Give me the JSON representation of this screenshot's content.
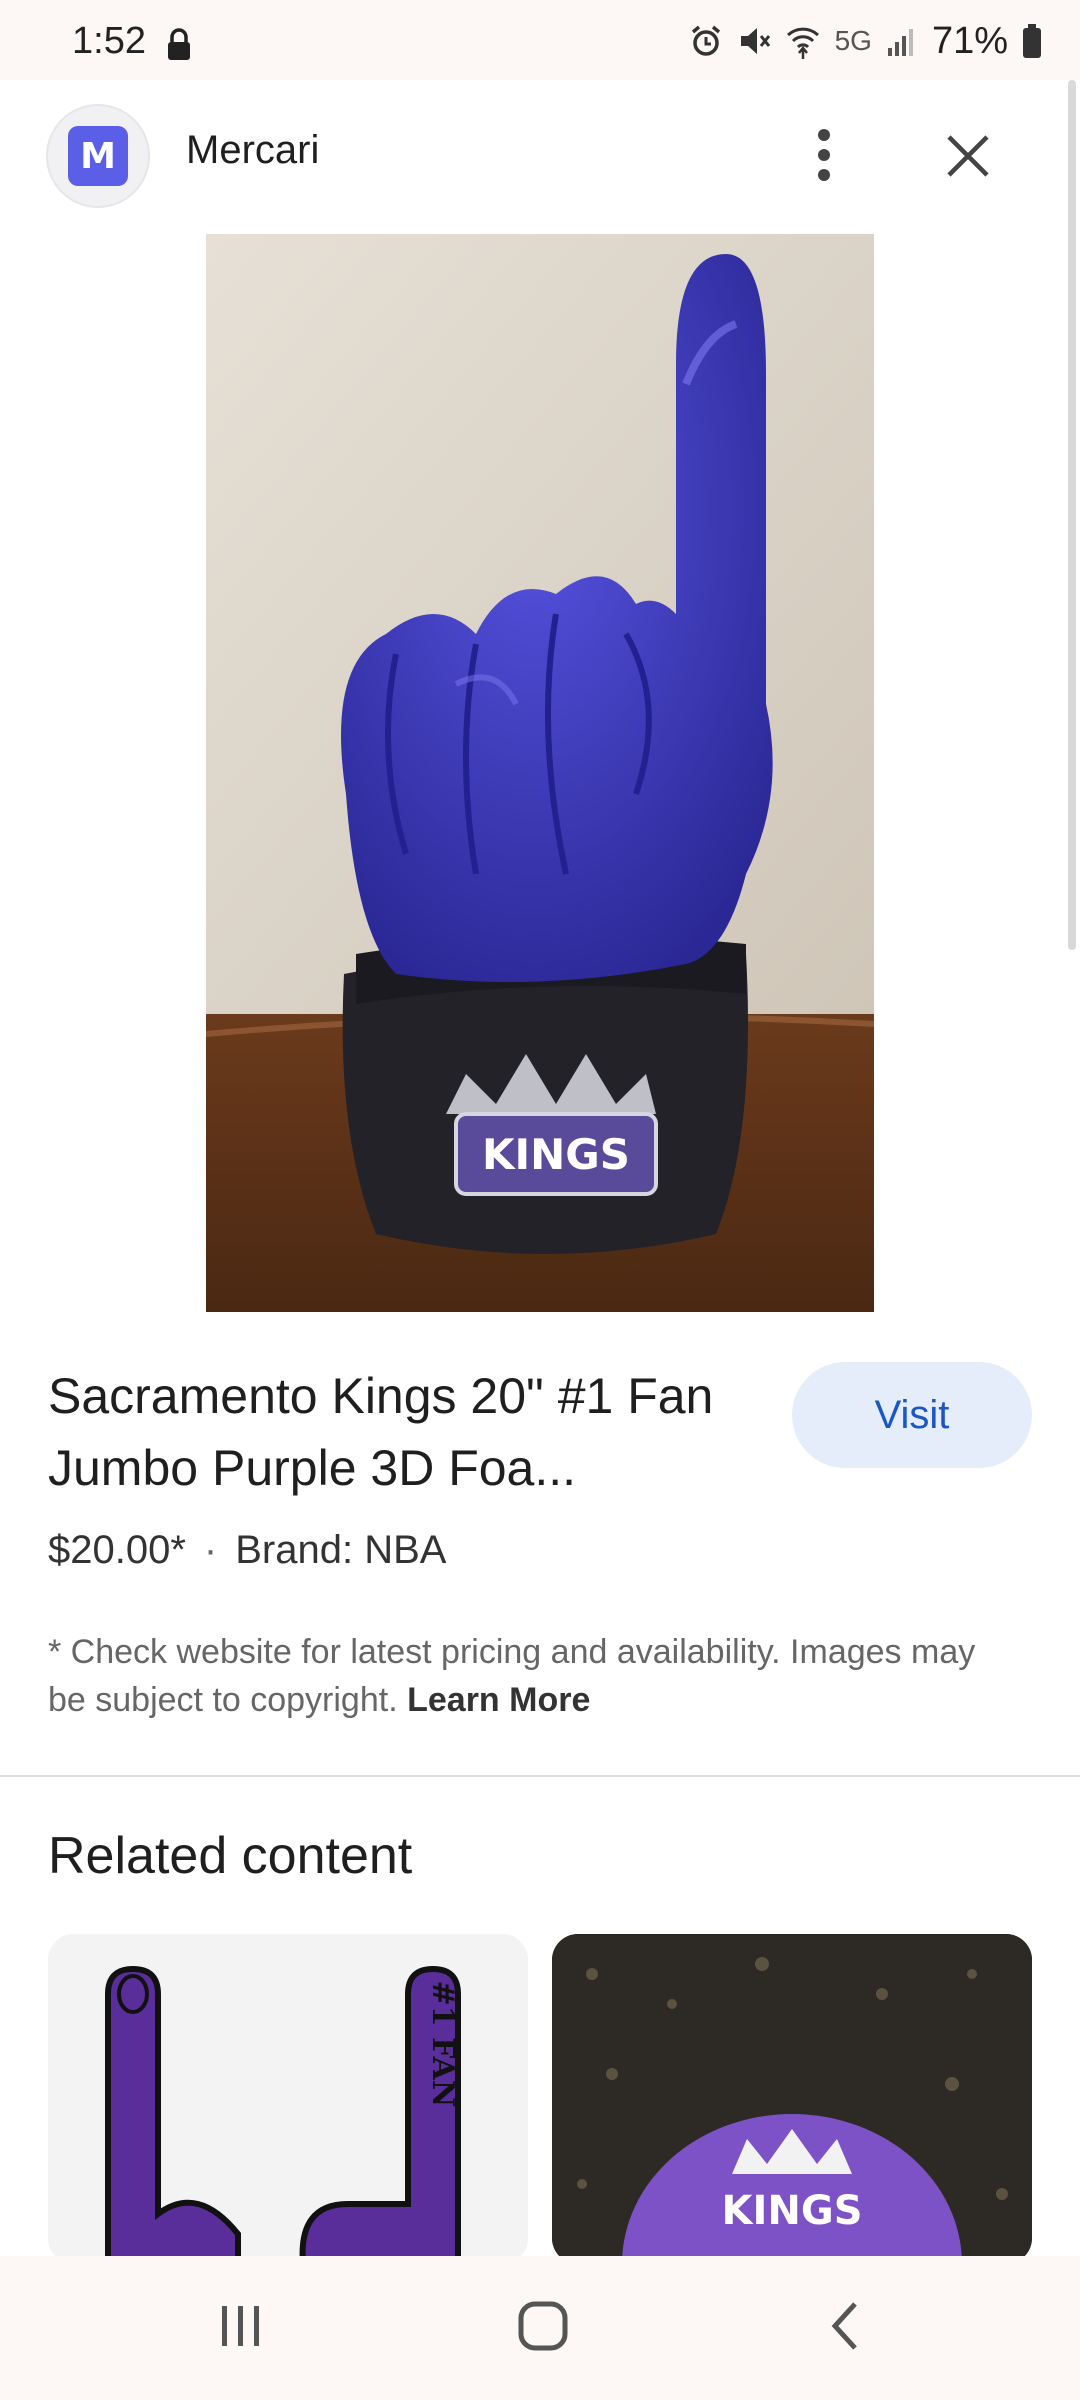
{
  "status_bar": {
    "time": "1:52",
    "network": "5G",
    "battery": "71%"
  },
  "header": {
    "app_name": "Mercari",
    "logo_letter": "M"
  },
  "product": {
    "title": "Sacramento Kings 20\" #1 Fan Jumbo Purple 3D Foa...",
    "visit_label": "Visit",
    "price": "$20.00*",
    "brand": "Brand: NBA",
    "disclaimer": "* Check website for latest pricing and availability. Images may be subject to copyright.",
    "learn_more": "Learn More",
    "image_logo_text": "KINGS"
  },
  "related": {
    "heading": "Related content",
    "card1_text": "#1 FAN",
    "card2_text": "KINGS"
  },
  "colors": {
    "accent": "#1a56c4",
    "visit_bg": "#e6edfa",
    "foam_purple": "#3a37b8"
  },
  "icons": [
    "lock-icon",
    "alarm-icon",
    "mute-icon",
    "wifi-icon",
    "signal-icon",
    "battery-icon",
    "more-vert-icon",
    "close-icon",
    "recents-icon",
    "home-icon",
    "back-icon"
  ]
}
